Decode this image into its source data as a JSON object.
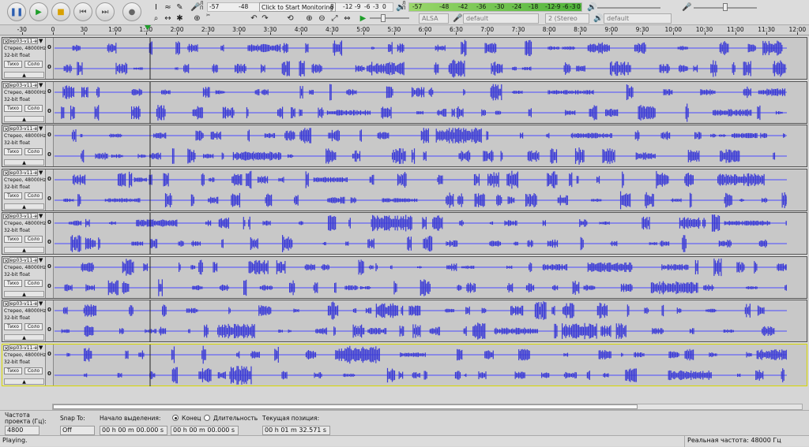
{
  "toolbar": {
    "play_meter_ticks": [
      "-57",
      "-48",
      "Click to Start Monitoring",
      "8",
      "-12",
      "-9",
      "-6",
      "-3",
      "0"
    ],
    "rec_meter_ticks": [
      "-57",
      "-54",
      "-48",
      "-42",
      "-36",
      "-30",
      "-24",
      "-18",
      "-12",
      "-9",
      "-6",
      "-3",
      "0"
    ],
    "host": "ALSA",
    "out_device": "default",
    "channels": "2 (Stereo",
    "in_device": "default",
    "play_meter_label": "Л\nП",
    "rec_meter_label": "Л\nП"
  },
  "ruler": {
    "labels": [
      "-30",
      "0",
      "30",
      "1:00",
      "1:30",
      "2:00",
      "2:30",
      "3:00",
      "3:30",
      "4:00",
      "4:30",
      "5:00",
      "5:30",
      "6:00",
      "6:30",
      "7:00",
      "7:30",
      "8:00",
      "8:30",
      "9:00",
      "9:30",
      "10:00",
      "10:30",
      "11:00",
      "11:30",
      "12:00"
    ]
  },
  "tracks": [
    {
      "name": "ep03-v11-e",
      "rate": "Стерео, 48000Hz",
      "format": "32-bit float",
      "mute": "Тихо",
      "solo": "Соло",
      "scale": "0"
    },
    {
      "name": "ep03-v11-e",
      "rate": "Стерео, 48000Hz",
      "format": "32-bit float",
      "mute": "Тихо",
      "solo": "Соло",
      "scale": "0"
    },
    {
      "name": "ep03-v11-e",
      "rate": "Стерео, 48000Hz",
      "format": "32-bit float",
      "mute": "Тихо",
      "solo": "Соло",
      "scale": "0"
    },
    {
      "name": "ep03-v11-e",
      "rate": "Стерео, 48000Hz",
      "format": "32-bit float",
      "mute": "Тихо",
      "solo": "Соло",
      "scale": "0"
    },
    {
      "name": "ep03-v11-e",
      "rate": "Стерео, 48000Hz",
      "format": "32-bit float",
      "mute": "Тихо",
      "solo": "Соло",
      "scale": "0"
    },
    {
      "name": "ep03-v11-e",
      "rate": "Стерео, 48000Hz",
      "format": "32-bit float",
      "mute": "Тихо",
      "solo": "Соло",
      "scale": "0"
    },
    {
      "name": "ep03-v11-e",
      "rate": "Стерео, 48000Hz",
      "format": "32-bit float",
      "mute": "Тихо",
      "solo": "Соло",
      "scale": "0"
    },
    {
      "name": "ep03-v11-e",
      "rate": "Стерео, 48000Hz",
      "format": "32-bit float",
      "mute": "Тихо",
      "solo": "Соло",
      "scale": "0"
    }
  ],
  "selection_bar": {
    "rate_label_1": "Частота",
    "rate_label_2": "проекта (Гц):",
    "rate_value": "4800",
    "snap_label": "Snap To:",
    "snap_value": "Off",
    "sel_start_label": "Начало выделения:",
    "end_label": "Конец",
    "length_label": "Длительность",
    "position_label": "Текущая позиция:",
    "sel_start_value": "00 h 00 m 00.000 s",
    "sel_end_value": "00 h 00 m 00.000 s",
    "position_value": "00 h 01 m 32.571 s"
  },
  "status": {
    "left": "Playing.",
    "right": "Реальная частота: 48000 Гц"
  },
  "colors": {
    "wave": "#3a3ad6",
    "wave_center": "#4a4aff",
    "track_bg": "#c8c8c8",
    "selected_border": "#d8d800"
  }
}
